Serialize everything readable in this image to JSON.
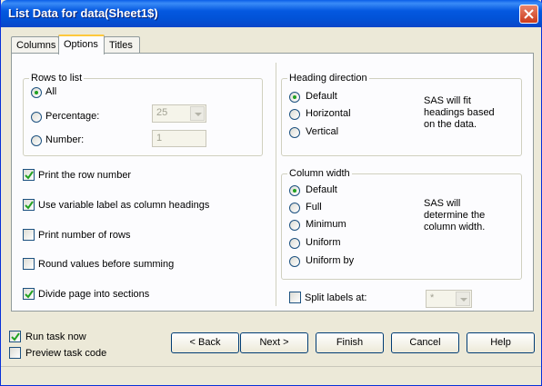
{
  "window": {
    "title": "List Data for data(Sheet1$)",
    "accent_color": "#0458e0"
  },
  "tabs": [
    {
      "label": "Columns",
      "selected": false
    },
    {
      "label": "Options",
      "selected": true
    },
    {
      "label": "Titles",
      "selected": false
    }
  ],
  "rows_to_list": {
    "title": "Rows to list",
    "all_label": "All",
    "percentage_label": "Percentage:",
    "percentage_value": "25",
    "number_label": "Number:",
    "number_value": "1",
    "selected": "All"
  },
  "options": {
    "print_row_number": {
      "label": "Print the row number",
      "checked": true
    },
    "use_variable_label": {
      "label": "Use variable label as column headings",
      "checked": true
    },
    "print_number_of_rows": {
      "label": "Print number of rows",
      "checked": false
    },
    "round_values": {
      "label": "Round values before summing",
      "checked": false
    },
    "divide_page": {
      "label": "Divide page into sections",
      "checked": true
    }
  },
  "heading_direction": {
    "title": "Heading direction",
    "options": [
      "Default",
      "Horizontal",
      "Vertical"
    ],
    "selected": "Default",
    "note": "SAS will fit\nheadings based\non the data."
  },
  "column_width": {
    "title": "Column width",
    "options": [
      "Default",
      "Full",
      "Minimum",
      "Uniform",
      "Uniform by"
    ],
    "selected": "Default",
    "note": "SAS will\ndetermine the\ncolumn width."
  },
  "split_labels": {
    "label": "Split labels at:",
    "checked": false,
    "value": "*"
  },
  "footer": {
    "run_task_now": {
      "label": "Run task now",
      "checked": true
    },
    "preview_task_code": {
      "label": "Preview task code",
      "checked": false
    }
  },
  "buttons": {
    "back": "< Back",
    "next": "Next >",
    "finish": "Finish",
    "cancel": "Cancel",
    "help": "Help"
  }
}
